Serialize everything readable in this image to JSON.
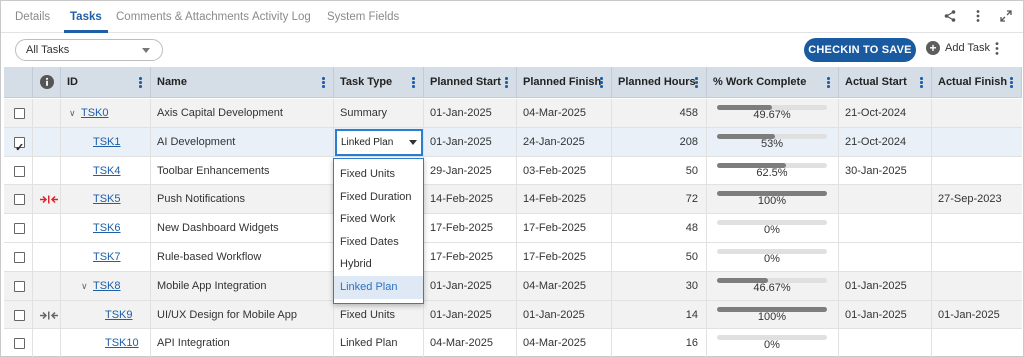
{
  "tabs": [
    "Details",
    "Tasks",
    "Comments & Attachments",
    "Activity Log",
    "System Fields"
  ],
  "active_tab": "Tasks",
  "top_icons": [
    "share-icon",
    "more-vertical-icon",
    "expand-icon"
  ],
  "toolbar": {
    "filter_value": "All Tasks",
    "checkin_label": "CHECKIN TO SAVE",
    "add_task_label": "Add Task"
  },
  "columns": {
    "id": "ID",
    "name": "Name",
    "task_type": "Task Type",
    "planned_start": "Planned Start",
    "planned_finish": "Planned Finish",
    "planned_hours": "Planned Hours",
    "work_complete": "% Work Complete",
    "actual_start": "Actual Start",
    "actual_finish": "Actual Finish"
  },
  "rows": [
    {
      "id": "TSK0",
      "name": "Axis Capital Development",
      "type": "Summary",
      "pstart": "01-Jan-2025",
      "pfinish": "04-Mar-2025",
      "hours": "458",
      "pct": "49.67%",
      "pct_val": 49.67,
      "astart": "21-Oct-2024",
      "afinish": "",
      "checked": false,
      "level": 0,
      "expander": true,
      "dep": ""
    },
    {
      "id": "TSK1",
      "name": "AI Development",
      "type": "Linked Plan",
      "pstart": "01-Jan-2025",
      "pfinish": "24-Jan-2025",
      "hours": "208",
      "pct": "53%",
      "pct_val": 53,
      "astart": "21-Oct-2024",
      "afinish": "",
      "checked": true,
      "level": 1,
      "expander": false,
      "dep": ""
    },
    {
      "id": "TSK4",
      "name": "Toolbar Enhancements",
      "type": "",
      "pstart": "29-Jan-2025",
      "pfinish": "03-Feb-2025",
      "hours": "50",
      "pct": "62.5%",
      "pct_val": 62.5,
      "astart": "30-Jan-2025",
      "afinish": "",
      "checked": false,
      "level": 1,
      "expander": false,
      "dep": ""
    },
    {
      "id": "TSK5",
      "name": "Push Notifications",
      "type": "",
      "pstart": "14-Feb-2025",
      "pfinish": "14-Feb-2025",
      "hours": "72",
      "pct": "100%",
      "pct_val": 100,
      "astart": "",
      "afinish": "27-Sep-2023",
      "checked": false,
      "level": 1,
      "expander": false,
      "dep": "red"
    },
    {
      "id": "TSK6",
      "name": "New Dashboard Widgets",
      "type": "",
      "pstart": "17-Feb-2025",
      "pfinish": "17-Feb-2025",
      "hours": "48",
      "pct": "0%",
      "pct_val": 0,
      "astart": "",
      "afinish": "",
      "checked": false,
      "level": 1,
      "expander": false,
      "dep": ""
    },
    {
      "id": "TSK7",
      "name": "Rule-based Workflow",
      "type": "",
      "pstart": "17-Feb-2025",
      "pfinish": "17-Feb-2025",
      "hours": "50",
      "pct": "0%",
      "pct_val": 0,
      "astart": "",
      "afinish": "",
      "checked": false,
      "level": 1,
      "expander": false,
      "dep": ""
    },
    {
      "id": "TSK8",
      "name": "Mobile App Integration",
      "type": "",
      "pstart": "01-Jan-2025",
      "pfinish": "04-Mar-2025",
      "hours": "30",
      "pct": "46.67%",
      "pct_val": 46.67,
      "astart": "01-Jan-2025",
      "afinish": "",
      "checked": false,
      "level": 1,
      "expander": true,
      "dep": ""
    },
    {
      "id": "TSK9",
      "name": "UI/UX Design for Mobile App",
      "type": "Fixed Units",
      "pstart": "01-Jan-2025",
      "pfinish": "01-Jan-2025",
      "hours": "14",
      "pct": "100%",
      "pct_val": 100,
      "astart": "01-Jan-2025",
      "afinish": "01-Jan-2025",
      "checked": false,
      "level": 2,
      "expander": false,
      "dep": "gray"
    },
    {
      "id": "TSK10",
      "name": "API Integration",
      "type": "Linked Plan",
      "pstart": "04-Mar-2025",
      "pfinish": "04-Mar-2025",
      "hours": "16",
      "pct": "0%",
      "pct_val": 0,
      "astart": "",
      "afinish": "",
      "checked": false,
      "level": 2,
      "expander": false,
      "dep": ""
    }
  ],
  "dropdown": {
    "value": "Linked Plan",
    "options": [
      "Fixed Units",
      "Fixed Duration",
      "Fixed Work",
      "Fixed Dates",
      "Hybrid",
      "Linked Plan"
    ],
    "selected": "Linked Plan"
  },
  "colors": {
    "accent": "#1e5fa8",
    "header_bg": "#d5dde6",
    "bar_fill": "#7d7d7d",
    "dependency_red": "#d9262f"
  }
}
